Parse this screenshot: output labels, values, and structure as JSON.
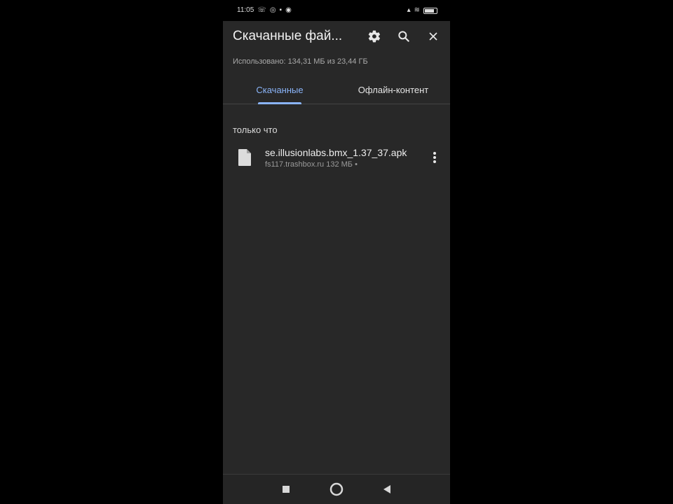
{
  "status_bar": {
    "time": "11:05"
  },
  "header": {
    "title": "Скачанные фай...",
    "icons": [
      "settings-icon",
      "search-icon",
      "close-icon"
    ]
  },
  "storage_info": "Использовано: 134,31 МБ из 23,44 ГБ",
  "tabs": [
    {
      "label": "Скачанные",
      "active": true
    },
    {
      "label": "Офлайн-контент",
      "active": false
    }
  ],
  "section": {
    "label": "только что"
  },
  "downloads": [
    {
      "name": "se.illusionlabs.bmx_1.37_37.apk",
      "meta": "fs117.trashbox.ru 132 МБ •"
    }
  ],
  "colors": {
    "accent": "#8ab4f8",
    "background": "#282828"
  }
}
